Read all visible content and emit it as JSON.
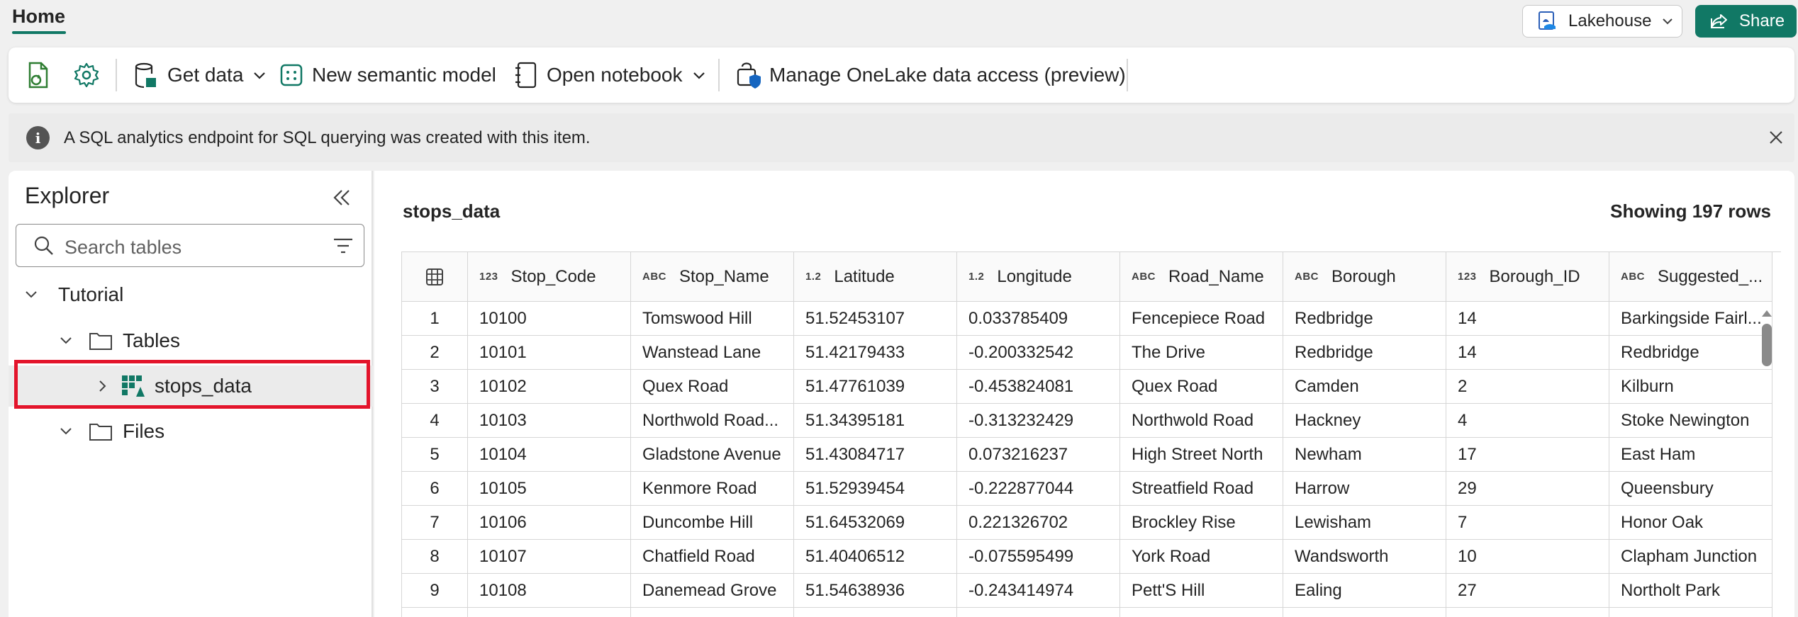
{
  "header": {
    "home_tab": "Home",
    "lakehouse_label": "Lakehouse",
    "share_label": "Share"
  },
  "ribbon": {
    "get_data": "Get data",
    "new_semantic_model": "New semantic model",
    "open_notebook": "Open notebook",
    "manage_onelake": "Manage OneLake data access (preview)"
  },
  "message": {
    "text": "A SQL analytics endpoint for SQL querying was created with this item."
  },
  "explorer": {
    "title": "Explorer",
    "search_placeholder": "Search tables",
    "tree": {
      "tutorial": "Tutorial",
      "tables": "Tables",
      "stops_data": "stops_data",
      "files": "Files"
    }
  },
  "table": {
    "name": "stops_data",
    "row_count": "Showing 197 rows",
    "columns": [
      {
        "type": "123",
        "name": "Stop_Code"
      },
      {
        "type": "ABC",
        "name": "Stop_Name"
      },
      {
        "type": "1.2",
        "name": "Latitude"
      },
      {
        "type": "1.2",
        "name": "Longitude"
      },
      {
        "type": "ABC",
        "name": "Road_Name"
      },
      {
        "type": "ABC",
        "name": "Borough"
      },
      {
        "type": "123",
        "name": "Borough_ID"
      },
      {
        "type": "ABC",
        "name": "Suggested_..."
      }
    ],
    "rows": [
      [
        "1",
        "10100",
        "Tomswood Hill",
        "51.52453107",
        "0.033785409",
        "Fencepiece Road",
        "Redbridge",
        "14",
        "Barkingside Fairl..."
      ],
      [
        "2",
        "10101",
        "Wanstead Lane",
        "51.42179433",
        "-0.200332542",
        "The Drive",
        "Redbridge",
        "14",
        "Redbridge"
      ],
      [
        "3",
        "10102",
        "Quex Road",
        "51.47761039",
        "-0.453824081",
        "Quex Road",
        "Camden",
        "2",
        "Kilburn"
      ],
      [
        "4",
        "10103",
        "Northwold Road...",
        "51.34395181",
        "-0.313232429",
        "Northwold Road",
        "Hackney",
        "4",
        "Stoke Newington"
      ],
      [
        "5",
        "10104",
        "Gladstone Avenue",
        "51.43084717",
        "0.073216237",
        "High Street North",
        "Newham",
        "17",
        "East Ham"
      ],
      [
        "6",
        "10105",
        "Kenmore Road",
        "51.52939454",
        "-0.222877044",
        "Streatfield Road",
        "Harrow",
        "29",
        "Queensbury"
      ],
      [
        "7",
        "10106",
        "Duncombe Hill",
        "51.64532069",
        "0.221326702",
        "Brockley Rise",
        "Lewisham",
        "7",
        "Honor Oak"
      ],
      [
        "8",
        "10107",
        "Chatfield Road",
        "51.40406512",
        "-0.075595499",
        "York Road",
        "Wandsworth",
        "10",
        "Clapham Junction"
      ],
      [
        "9",
        "10108",
        "Danemead Grove",
        "51.54638936",
        "-0.243414974",
        "Pett'S Hill",
        "Ealing",
        "27",
        "Northolt Park"
      ],
      [
        "",
        "",
        "",
        "",
        "",
        "",
        "",
        "",
        ""
      ]
    ]
  },
  "colors": {
    "accent": "#117865",
    "highlight": "#e3142b"
  }
}
